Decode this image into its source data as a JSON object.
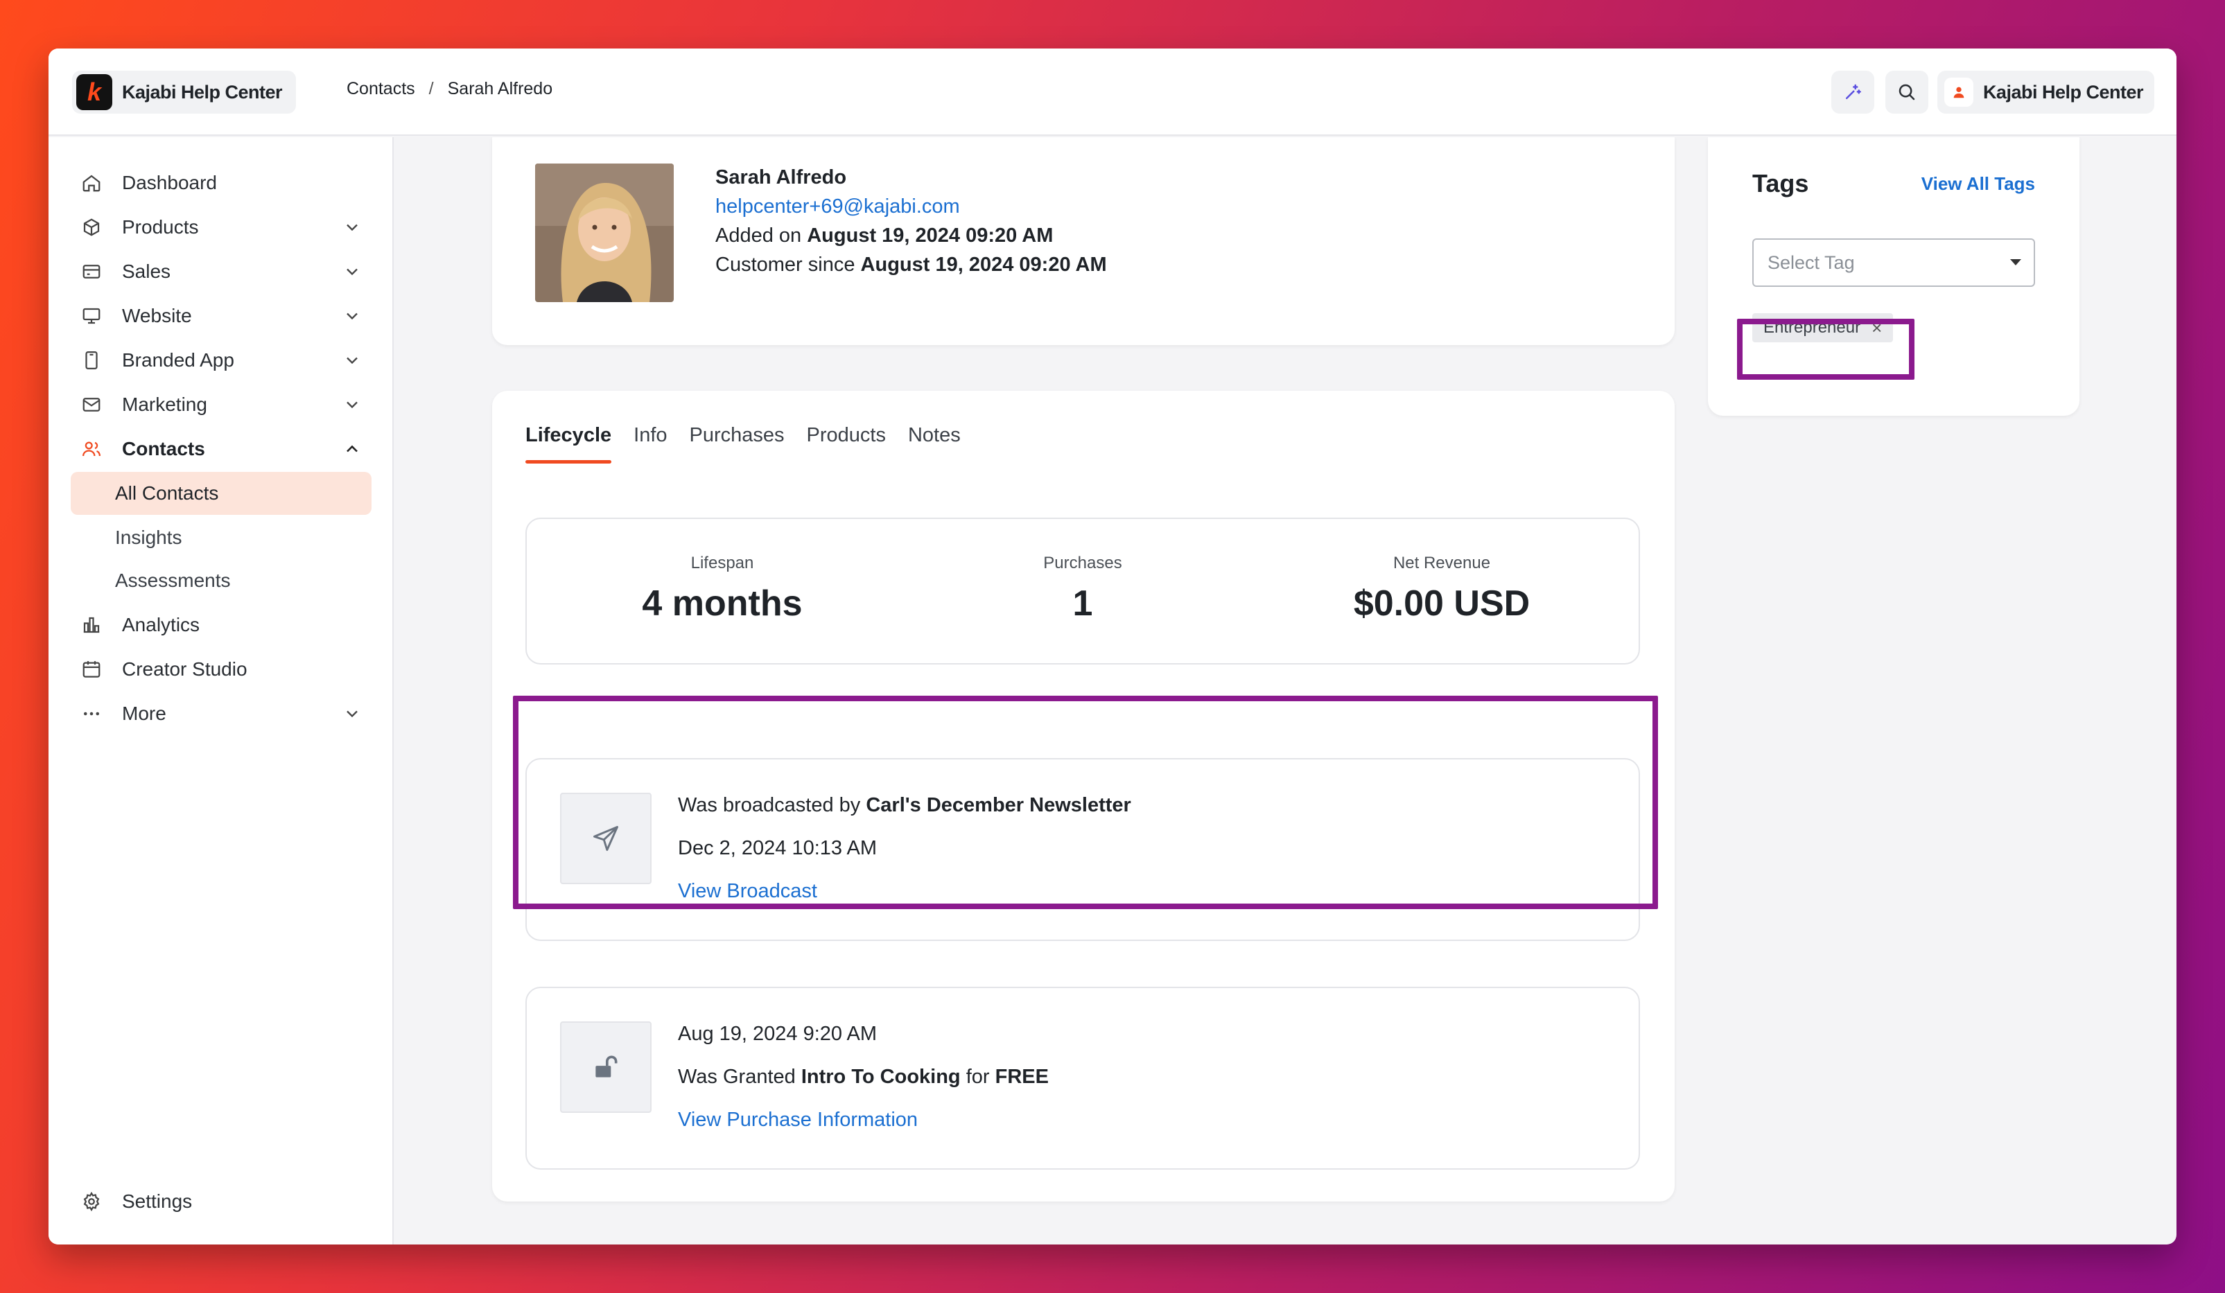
{
  "header": {
    "brand": "Kajabi Help Center",
    "breadcrumb": [
      "Contacts",
      "Sarah Alfredo"
    ],
    "breadcrumb_sep": "/",
    "account_name": "Kajabi Help Center"
  },
  "sidebar": {
    "items": [
      {
        "label": "Dashboard",
        "icon": "home-icon"
      },
      {
        "label": "Products",
        "icon": "box-icon"
      },
      {
        "label": "Sales",
        "icon": "credit-card-icon"
      },
      {
        "label": "Website",
        "icon": "monitor-icon"
      },
      {
        "label": "Branded App",
        "icon": "phone-icon"
      },
      {
        "label": "Marketing",
        "icon": "mail-icon"
      },
      {
        "label": "Contacts",
        "icon": "users-icon"
      },
      {
        "label": "Analytics",
        "icon": "bar-chart-icon"
      },
      {
        "label": "Creator Studio",
        "icon": "calendar-icon"
      },
      {
        "label": "More",
        "icon": "more-icon"
      }
    ],
    "contacts_sub": [
      "All Contacts",
      "Insights",
      "Assessments"
    ],
    "settings": "Settings"
  },
  "profile": {
    "name": "Sarah Alfredo",
    "email": "helpcenter+69@kajabi.com",
    "added_prefix": "Added on",
    "added_date": "August 19, 2024 09:20 AM",
    "customer_prefix": "Customer since",
    "customer_date": "August 19, 2024 09:20 AM"
  },
  "tabs": [
    "Lifecycle",
    "Info",
    "Purchases",
    "Products",
    "Notes"
  ],
  "stats": [
    {
      "label": "Lifespan",
      "value": "4 months"
    },
    {
      "label": "Purchases",
      "value": "1"
    },
    {
      "label": "Net Revenue",
      "value": "$0.00 USD"
    }
  ],
  "events": [
    {
      "icon": "paper-plane-icon",
      "line1_prefix": "Was broadcasted by",
      "line1_bold": "Carl's December Newsletter",
      "line2": "Dec 2, 2024 10:13 AM",
      "link": "View Broadcast"
    },
    {
      "icon": "unlock-icon",
      "line1": "Aug 19, 2024 9:20 AM",
      "line2_prefix": "Was Granted",
      "line2_bold": "Intro To Cooking",
      "line2_mid": "for",
      "line2_bold2": "FREE",
      "link": "View Purchase Information"
    }
  ],
  "tags": {
    "title": "Tags",
    "view_all": "View All Tags",
    "select_placeholder": "Select Tag",
    "items": [
      {
        "label": "Entrepreneur",
        "remove": "×"
      }
    ]
  },
  "colors": {
    "accent": "#f04a20",
    "link": "#1b6fd1",
    "highlight": "#8b1a8e"
  }
}
